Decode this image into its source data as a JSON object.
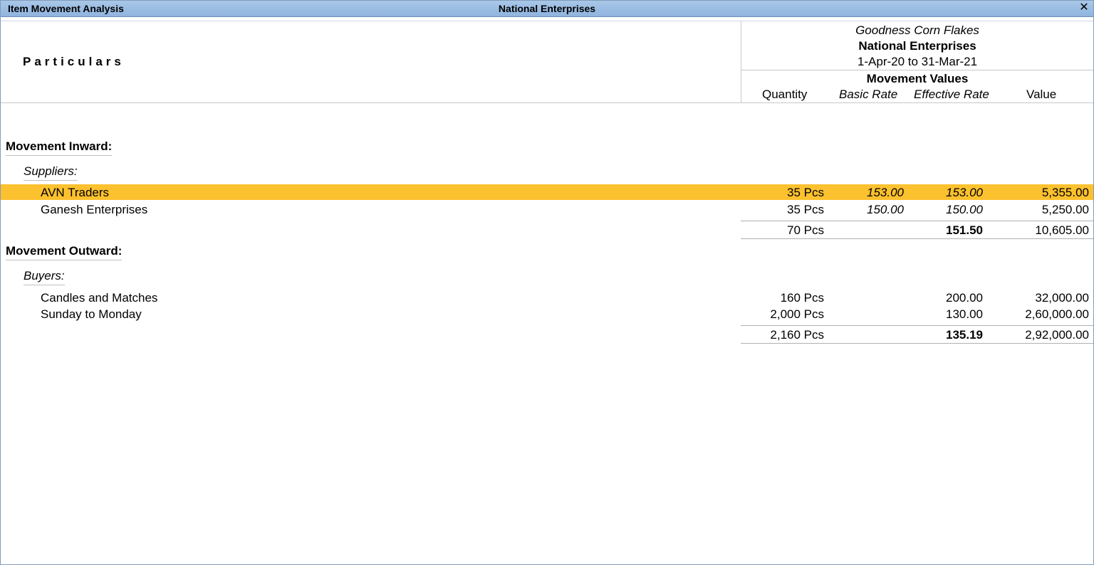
{
  "window": {
    "title_left": "Item Movement Analysis",
    "title_center": "National Enterprises",
    "close_glyph": "✕"
  },
  "header": {
    "particulars": "Particulars",
    "item_name": "Goodness Corn Flakes",
    "company": "National Enterprises",
    "period": "1-Apr-20 to 31-Mar-21",
    "movement_values": "Movement Values",
    "columns": {
      "quantity": "Quantity",
      "basic_rate": "Basic Rate",
      "effective_rate": "Effective Rate",
      "value": "Value"
    }
  },
  "inward": {
    "label": "Movement Inward:",
    "group": "Suppliers:",
    "rows": [
      {
        "name": "AVN Traders",
        "qty": "35 Pcs",
        "basic": "153.00",
        "effective": "153.00",
        "value": "5,355.00"
      },
      {
        "name": "Ganesh Enterprises",
        "qty": "35 Pcs",
        "basic": "150.00",
        "effective": "150.00",
        "value": "5,250.00"
      }
    ],
    "total": {
      "qty": "70 Pcs",
      "effective": "151.50",
      "value": "10,605.00"
    }
  },
  "outward": {
    "label": "Movement Outward:",
    "group": "Buyers:",
    "rows": [
      {
        "name": "Candles and Matches",
        "qty": "160 Pcs",
        "effective": "200.00",
        "value": "32,000.00"
      },
      {
        "name": "Sunday to Monday",
        "qty": "2,000 Pcs",
        "effective": "130.00",
        "value": "2,60,000.00"
      }
    ],
    "total": {
      "qty": "2,160 Pcs",
      "effective": "135.19",
      "value": "2,92,000.00"
    }
  },
  "colors": {
    "selection": "#fcc12e",
    "titlebar": "#8fb4de"
  }
}
